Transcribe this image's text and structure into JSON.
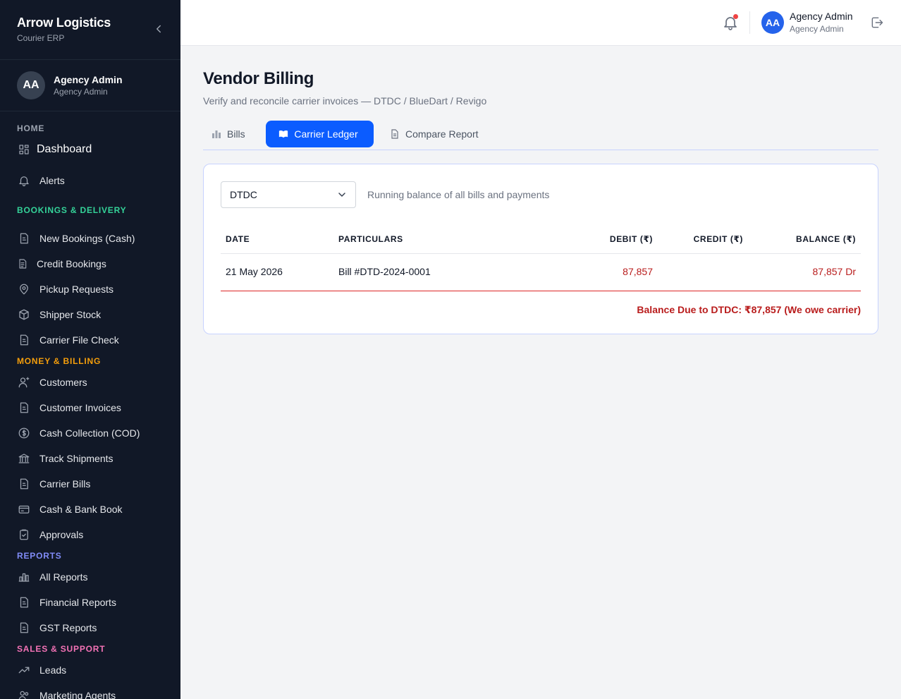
{
  "brand": {
    "title": "Arrow Logistics",
    "subtitle": "Courier ERP"
  },
  "sidebar_user": {
    "initials": "AA",
    "name": "Agency Admin",
    "role": "Agency Admin"
  },
  "sections": {
    "home": {
      "label": "HOME",
      "color": "#9ca3af"
    },
    "bookings": {
      "label": "BOOKINGS & DELIVERY",
      "color": "#34d399"
    },
    "money": {
      "label": "MONEY & BILLING",
      "color": "#f59e0b"
    },
    "reports": {
      "label": "REPORTS",
      "color": "#818cf8"
    },
    "sales": {
      "label": "SALES & SUPPORT",
      "color": "#f472b6"
    }
  },
  "nav": {
    "dashboard": "Dashboard",
    "alerts": "Alerts",
    "new_bookings": "New Bookings (Cash)",
    "credit_bookings": "Credit Bookings",
    "pickup_requests": "Pickup Requests",
    "shipper_stock": "Shipper Stock",
    "carrier_file_check": "Carrier File Check",
    "customers": "Customers",
    "customer_invoices": "Customer Invoices",
    "cash_collection": "Cash Collection (COD)",
    "track_shipments": "Track Shipments",
    "carrier_bills": "Carrier Bills",
    "cash_bank_book": "Cash & Bank Book",
    "approvals": "Approvals",
    "all_reports": "All Reports",
    "financial_reports": "Financial Reports",
    "gst_reports": "GST Reports",
    "leads": "Leads",
    "marketing_agents": "Marketing Agents"
  },
  "topbar": {
    "initials": "AA",
    "name": "Agency Admin",
    "role": "Agency Admin",
    "has_notification": true
  },
  "page": {
    "title": "Vendor Billing",
    "subtitle": "Verify and reconcile carrier invoices — DTDC / BlueDart / Revigo"
  },
  "tabs": {
    "bills": "Bills",
    "carrier_ledger": "Carrier Ledger",
    "compare_report": "Compare Report",
    "active": "carrier_ledger"
  },
  "ledger": {
    "carrier_selected": "DTDC",
    "hint": "Running balance of all bills and payments",
    "columns": {
      "date": "DATE",
      "particulars": "PARTICULARS",
      "debit": "DEBIT (₹)",
      "credit": "CREDIT (₹)",
      "balance": "BALANCE (₹)"
    },
    "rows": [
      {
        "date": "21 May 2026",
        "particulars": "Bill #DTD-2024-0001",
        "debit": "87,857",
        "credit": "",
        "balance": "87,857 Dr"
      }
    ],
    "balance_due": "Balance Due to DTDC: ₹87,857 (We owe carrier)"
  },
  "colors": {
    "sidebar_bg": "#111827",
    "accent": "#0b5cff",
    "debit_red": "#b91c1c"
  }
}
